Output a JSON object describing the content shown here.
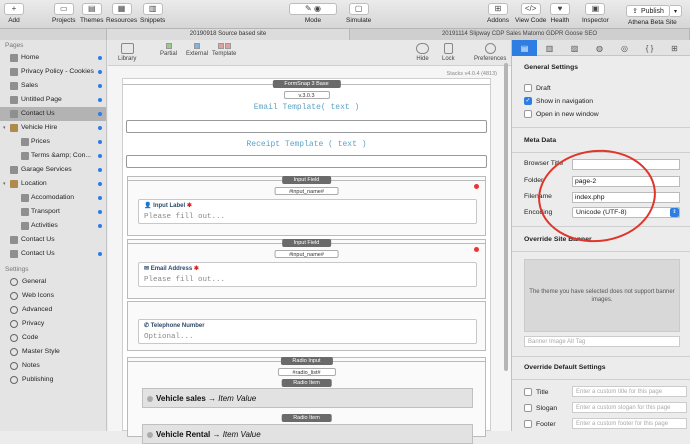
{
  "toolbar": {
    "add": "Add",
    "projects": "Projects",
    "themes": "Themes",
    "resources": "Resources",
    "snippets": "Snippets",
    "mode": "Mode",
    "simulate": "Simulate",
    "addons": "Addons",
    "view_code": "View Code",
    "health": "Health",
    "inspector": "Inspector",
    "publish": "Publish",
    "site_name": "Athena Beta Site"
  },
  "tabs": [
    "20190918 Source based site",
    "20191114 Slipway CDP Sales Matomo GDPR Goose SEO"
  ],
  "sidebar": {
    "pages_header": "Pages",
    "pages": [
      {
        "label": "Home",
        "dot": true
      },
      {
        "label": "Privacy Policy - Cookies",
        "dot": true
      },
      {
        "label": "Sales",
        "dot": true
      },
      {
        "label": "Untitled Page",
        "dot": true
      },
      {
        "label": "Contact Us",
        "dot": true,
        "selected": true
      },
      {
        "label": "Vehicle Hire",
        "dot": true,
        "folder": true
      },
      {
        "label": "Prices",
        "dot": true,
        "sub": true
      },
      {
        "label": "Terms &amp; Con...",
        "dot": true,
        "sub": true
      },
      {
        "label": "Garage Services",
        "dot": true
      },
      {
        "label": "Location",
        "dot": true,
        "folder": true
      },
      {
        "label": "Accomodation",
        "dot": true,
        "sub": true
      },
      {
        "label": "Transport",
        "dot": true,
        "sub": true
      },
      {
        "label": "Activities",
        "dot": true,
        "sub": true
      },
      {
        "label": "Contact Us",
        "dot": false
      },
      {
        "label": "Contact Us",
        "dot": true
      }
    ],
    "settings_header": "Settings",
    "settings": [
      "General",
      "Web Icons",
      "Advanced",
      "Privacy",
      "Code",
      "Master Style",
      "Notes",
      "Publishing"
    ]
  },
  "canvas": {
    "library": "Library",
    "partial": "Partial",
    "external": "External",
    "template": "Template",
    "hide": "Hide",
    "lock": "Lock",
    "preferences": "Preferences",
    "stacks_version": "Stacks v4.0.4 (4813)",
    "formsnap_title": "FormSnap 3 Base",
    "formsnap_version": "v.3.0.3",
    "email_template": "Email Template( text )",
    "receipt_template": "Receipt Template ( text )",
    "input_field_header": "Input Field",
    "input_name": "#input_name#",
    "fields": [
      {
        "label": "Input Label",
        "required": true,
        "placeholder": "Please fill out...",
        "icon": "👤"
      },
      {
        "label": "Email Address",
        "required": true,
        "placeholder": "Please fill out...",
        "icon": "✉"
      },
      {
        "label": "Telephone Number",
        "required": false,
        "placeholder": "Optional...",
        "icon": "✆"
      }
    ],
    "radio_input_header": "Radio Input",
    "radio_list": "#radio_list#",
    "radio_item_header": "Radio Item",
    "radio_item_title": "Vehicle sales",
    "radio_item_value": "Item Value",
    "radio_item_partial": "Vehicle Rental"
  },
  "inspector": {
    "general_settings": "General Settings",
    "draft": "Draft",
    "show_in_navigation": "Show in navigation",
    "open_in_new_window": "Open in new window",
    "meta_data": "Meta Data",
    "browser_title_label": "Browser Title",
    "browser_title_value": "",
    "folder_label": "Folder",
    "folder_value": "page-2",
    "filename_label": "Filename",
    "filename_value": "index.php",
    "encoding_label": "Encoding",
    "encoding_value": "Unicode (UTF-8)",
    "override_banner": "Override Site Banner",
    "banner_message": "The theme you have selected does not support banner images.",
    "banner_alt_placeholder": "Banner Image Alt Tag",
    "override_defaults": "Override Default Settings",
    "title_label": "Title",
    "title_placeholder": "Enter a custom title for this page",
    "slogan_label": "Slogan",
    "slogan_placeholder": "Enter a custom slogan for this page",
    "footer_label": "Footer",
    "footer_placeholder": "Enter a custom footer for this page"
  }
}
